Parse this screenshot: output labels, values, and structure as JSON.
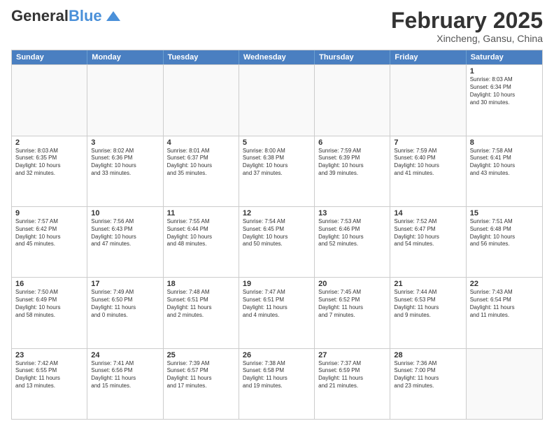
{
  "header": {
    "logo_general": "General",
    "logo_blue": "Blue",
    "month_title": "February 2025",
    "subtitle": "Xincheng, Gansu, China"
  },
  "weekdays": [
    "Sunday",
    "Monday",
    "Tuesday",
    "Wednesday",
    "Thursday",
    "Friday",
    "Saturday"
  ],
  "rows": [
    [
      {
        "day": "",
        "info": ""
      },
      {
        "day": "",
        "info": ""
      },
      {
        "day": "",
        "info": ""
      },
      {
        "day": "",
        "info": ""
      },
      {
        "day": "",
        "info": ""
      },
      {
        "day": "",
        "info": ""
      },
      {
        "day": "1",
        "info": "Sunrise: 8:03 AM\nSunset: 6:34 PM\nDaylight: 10 hours\nand 30 minutes."
      }
    ],
    [
      {
        "day": "2",
        "info": "Sunrise: 8:03 AM\nSunset: 6:35 PM\nDaylight: 10 hours\nand 32 minutes."
      },
      {
        "day": "3",
        "info": "Sunrise: 8:02 AM\nSunset: 6:36 PM\nDaylight: 10 hours\nand 33 minutes."
      },
      {
        "day": "4",
        "info": "Sunrise: 8:01 AM\nSunset: 6:37 PM\nDaylight: 10 hours\nand 35 minutes."
      },
      {
        "day": "5",
        "info": "Sunrise: 8:00 AM\nSunset: 6:38 PM\nDaylight: 10 hours\nand 37 minutes."
      },
      {
        "day": "6",
        "info": "Sunrise: 7:59 AM\nSunset: 6:39 PM\nDaylight: 10 hours\nand 39 minutes."
      },
      {
        "day": "7",
        "info": "Sunrise: 7:59 AM\nSunset: 6:40 PM\nDaylight: 10 hours\nand 41 minutes."
      },
      {
        "day": "8",
        "info": "Sunrise: 7:58 AM\nSunset: 6:41 PM\nDaylight: 10 hours\nand 43 minutes."
      }
    ],
    [
      {
        "day": "9",
        "info": "Sunrise: 7:57 AM\nSunset: 6:42 PM\nDaylight: 10 hours\nand 45 minutes."
      },
      {
        "day": "10",
        "info": "Sunrise: 7:56 AM\nSunset: 6:43 PM\nDaylight: 10 hours\nand 47 minutes."
      },
      {
        "day": "11",
        "info": "Sunrise: 7:55 AM\nSunset: 6:44 PM\nDaylight: 10 hours\nand 48 minutes."
      },
      {
        "day": "12",
        "info": "Sunrise: 7:54 AM\nSunset: 6:45 PM\nDaylight: 10 hours\nand 50 minutes."
      },
      {
        "day": "13",
        "info": "Sunrise: 7:53 AM\nSunset: 6:46 PM\nDaylight: 10 hours\nand 52 minutes."
      },
      {
        "day": "14",
        "info": "Sunrise: 7:52 AM\nSunset: 6:47 PM\nDaylight: 10 hours\nand 54 minutes."
      },
      {
        "day": "15",
        "info": "Sunrise: 7:51 AM\nSunset: 6:48 PM\nDaylight: 10 hours\nand 56 minutes."
      }
    ],
    [
      {
        "day": "16",
        "info": "Sunrise: 7:50 AM\nSunset: 6:49 PM\nDaylight: 10 hours\nand 58 minutes."
      },
      {
        "day": "17",
        "info": "Sunrise: 7:49 AM\nSunset: 6:50 PM\nDaylight: 11 hours\nand 0 minutes."
      },
      {
        "day": "18",
        "info": "Sunrise: 7:48 AM\nSunset: 6:51 PM\nDaylight: 11 hours\nand 2 minutes."
      },
      {
        "day": "19",
        "info": "Sunrise: 7:47 AM\nSunset: 6:51 PM\nDaylight: 11 hours\nand 4 minutes."
      },
      {
        "day": "20",
        "info": "Sunrise: 7:45 AM\nSunset: 6:52 PM\nDaylight: 11 hours\nand 7 minutes."
      },
      {
        "day": "21",
        "info": "Sunrise: 7:44 AM\nSunset: 6:53 PM\nDaylight: 11 hours\nand 9 minutes."
      },
      {
        "day": "22",
        "info": "Sunrise: 7:43 AM\nSunset: 6:54 PM\nDaylight: 11 hours\nand 11 minutes."
      }
    ],
    [
      {
        "day": "23",
        "info": "Sunrise: 7:42 AM\nSunset: 6:55 PM\nDaylight: 11 hours\nand 13 minutes."
      },
      {
        "day": "24",
        "info": "Sunrise: 7:41 AM\nSunset: 6:56 PM\nDaylight: 11 hours\nand 15 minutes."
      },
      {
        "day": "25",
        "info": "Sunrise: 7:39 AM\nSunset: 6:57 PM\nDaylight: 11 hours\nand 17 minutes."
      },
      {
        "day": "26",
        "info": "Sunrise: 7:38 AM\nSunset: 6:58 PM\nDaylight: 11 hours\nand 19 minutes."
      },
      {
        "day": "27",
        "info": "Sunrise: 7:37 AM\nSunset: 6:59 PM\nDaylight: 11 hours\nand 21 minutes."
      },
      {
        "day": "28",
        "info": "Sunrise: 7:36 AM\nSunset: 7:00 PM\nDaylight: 11 hours\nand 23 minutes."
      },
      {
        "day": "",
        "info": ""
      }
    ]
  ]
}
